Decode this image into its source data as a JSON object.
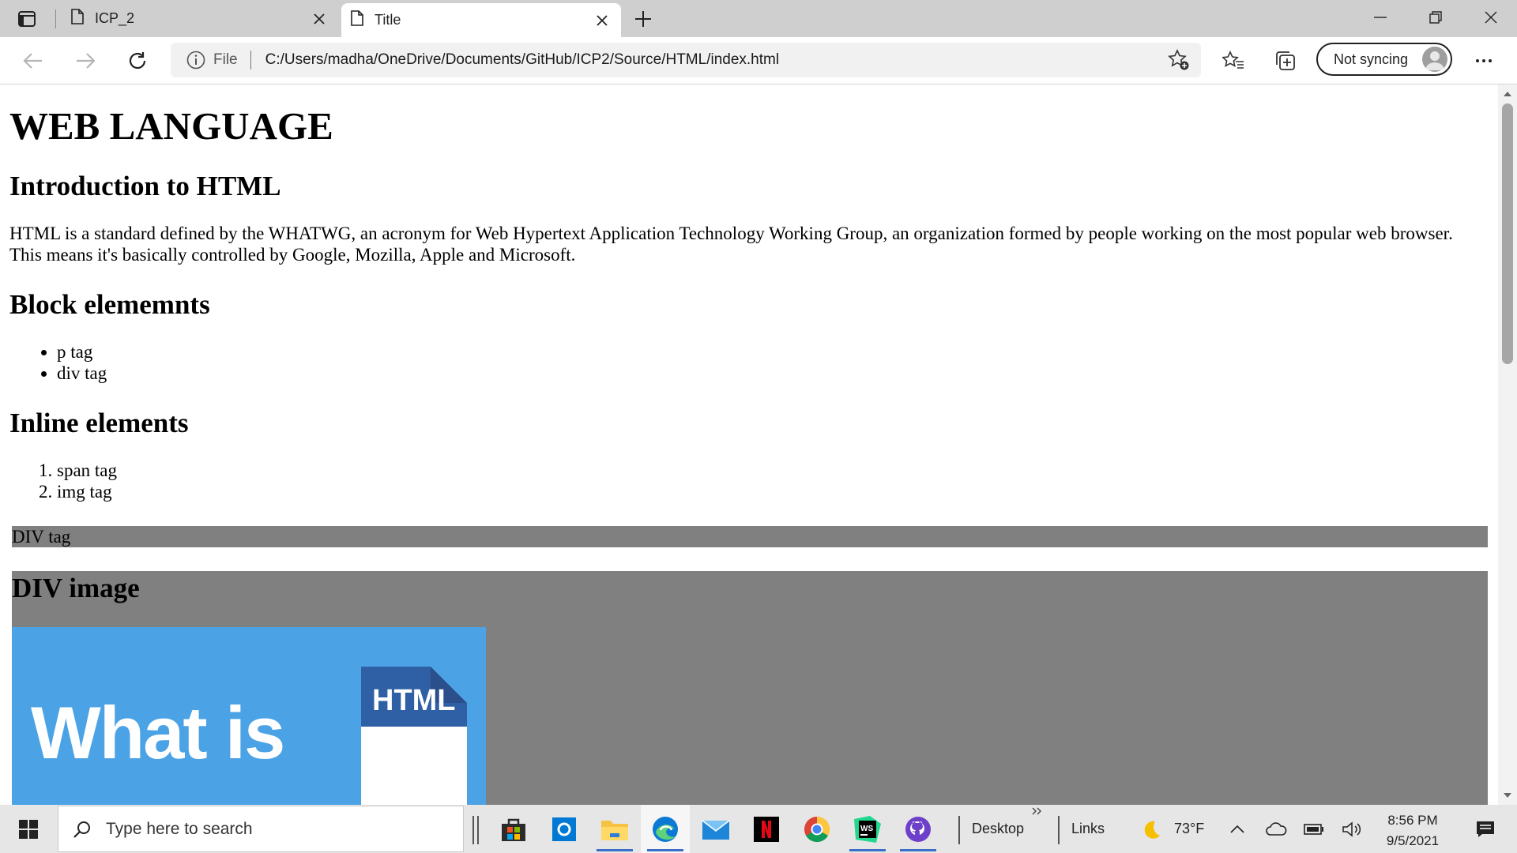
{
  "browser": {
    "tabs": [
      {
        "title": "ICP_2",
        "active": false
      },
      {
        "title": "Title",
        "active": true
      }
    ],
    "address": {
      "scheme_label": "File",
      "url": "C:/Users/madha/OneDrive/Documents/GitHub/ICP2/Source/HTML/index.html"
    },
    "profile": {
      "sync_label": "Not syncing"
    }
  },
  "page": {
    "h1": "WEB LANGUAGE",
    "intro_heading": "Introduction to HTML",
    "intro_text": "HTML is a standard defined by the WHATWG, an acronym for Web Hypertext Application Technology Working Group, an organization formed by people working on the most popular web browser. This means it's basically controlled by Google, Mozilla, Apple and Microsoft.",
    "block_heading": "Block elememnts",
    "block_items": [
      "p tag",
      "div tag"
    ],
    "inline_heading": "Inline elements",
    "inline_items": [
      "span tag",
      "img tag"
    ],
    "div_tag_text": "DIV tag",
    "div_image_heading": "DIV image",
    "image_text": "What is",
    "image_logo_text": "HTML"
  },
  "taskbar": {
    "search_placeholder": "Type here to search",
    "desktop_label": "Desktop",
    "links_label": "Links",
    "weather": "73°F",
    "time": "8:56 PM",
    "date": "9/5/2021"
  }
}
